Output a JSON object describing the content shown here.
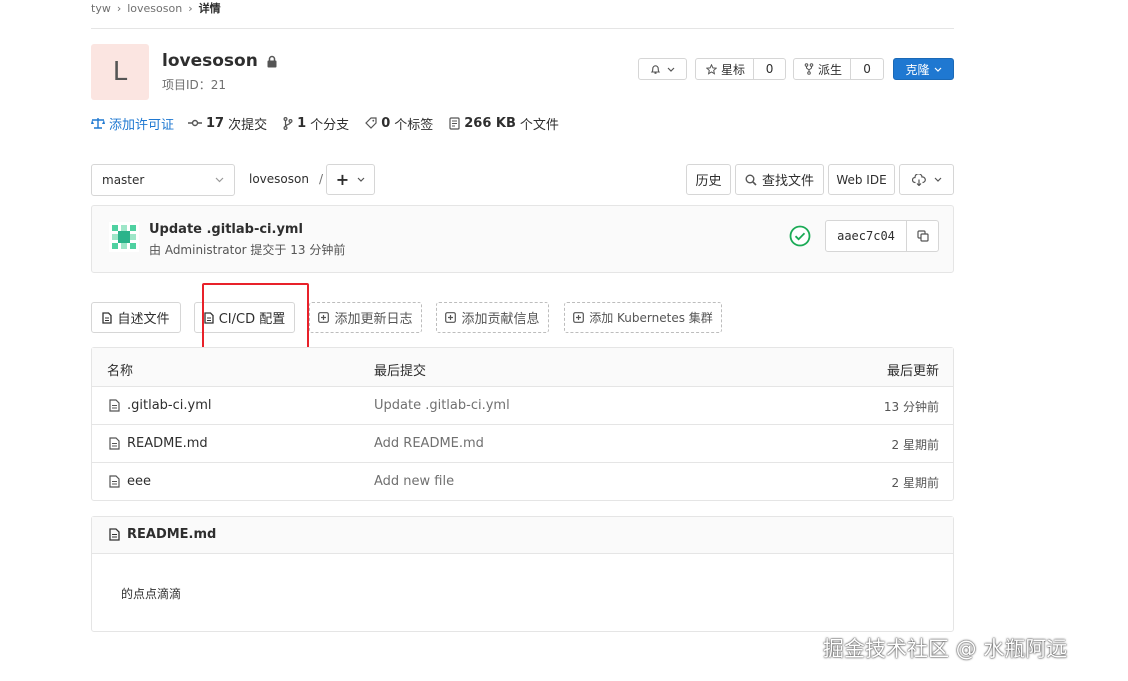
{
  "breadcrumb": {
    "group": "tyw",
    "project": "lovesoson",
    "current": "详情"
  },
  "project": {
    "avatar_letter": "L",
    "name": "lovesoson",
    "id_label": "项目ID：",
    "id_value": "21",
    "star_label": "星标",
    "star_count": "0",
    "fork_label": "派生",
    "fork_count": "0",
    "clone_label": "克隆"
  },
  "stats": {
    "license": "添加许可证",
    "commits_num": "17",
    "commits_label": "次提交",
    "branches_num": "1",
    "branches_label": "个分支",
    "tags_num": "0",
    "tags_label": "个标签",
    "size_num": "266 KB",
    "size_label": "个文件"
  },
  "toolbar": {
    "branch": "master",
    "path": "lovesoson",
    "path_sep": "/",
    "add": "+",
    "history": "历史",
    "find_file": "查找文件",
    "web_ide": "Web IDE"
  },
  "last_commit": {
    "title": "Update .gitlab-ci.yml",
    "meta": "由 Administrator 提交于 13 分钟前",
    "sha": "aaec7c04",
    "status_color": "#1aaa55"
  },
  "quick_links": {
    "readme": "自述文件",
    "cicd": "CI/CD 配置",
    "changelog": "添加更新日志",
    "contributing": "添加贡献信息",
    "kubernetes": "添加 Kubernetes 集群"
  },
  "table": {
    "headers": [
      "名称",
      "最后提交",
      "最后更新"
    ],
    "rows": [
      {
        "name": ".gitlab-ci.yml",
        "commit": "Update .gitlab-ci.yml",
        "updated": "13 分钟前"
      },
      {
        "name": "README.md",
        "commit": "Add README.md",
        "updated": "2 星期前"
      },
      {
        "name": "eee",
        "commit": "Add new file",
        "updated": "2 星期前"
      }
    ]
  },
  "readme": {
    "filename": "README.md",
    "content": "的点点滴滴"
  },
  "watermark": "掘金技术社区 @ 水瓶阿远",
  "colors": {
    "brand_blue": "#1f78d1",
    "highlight_red": "#e8212a",
    "avatar_bg": "#fbe5e1"
  }
}
